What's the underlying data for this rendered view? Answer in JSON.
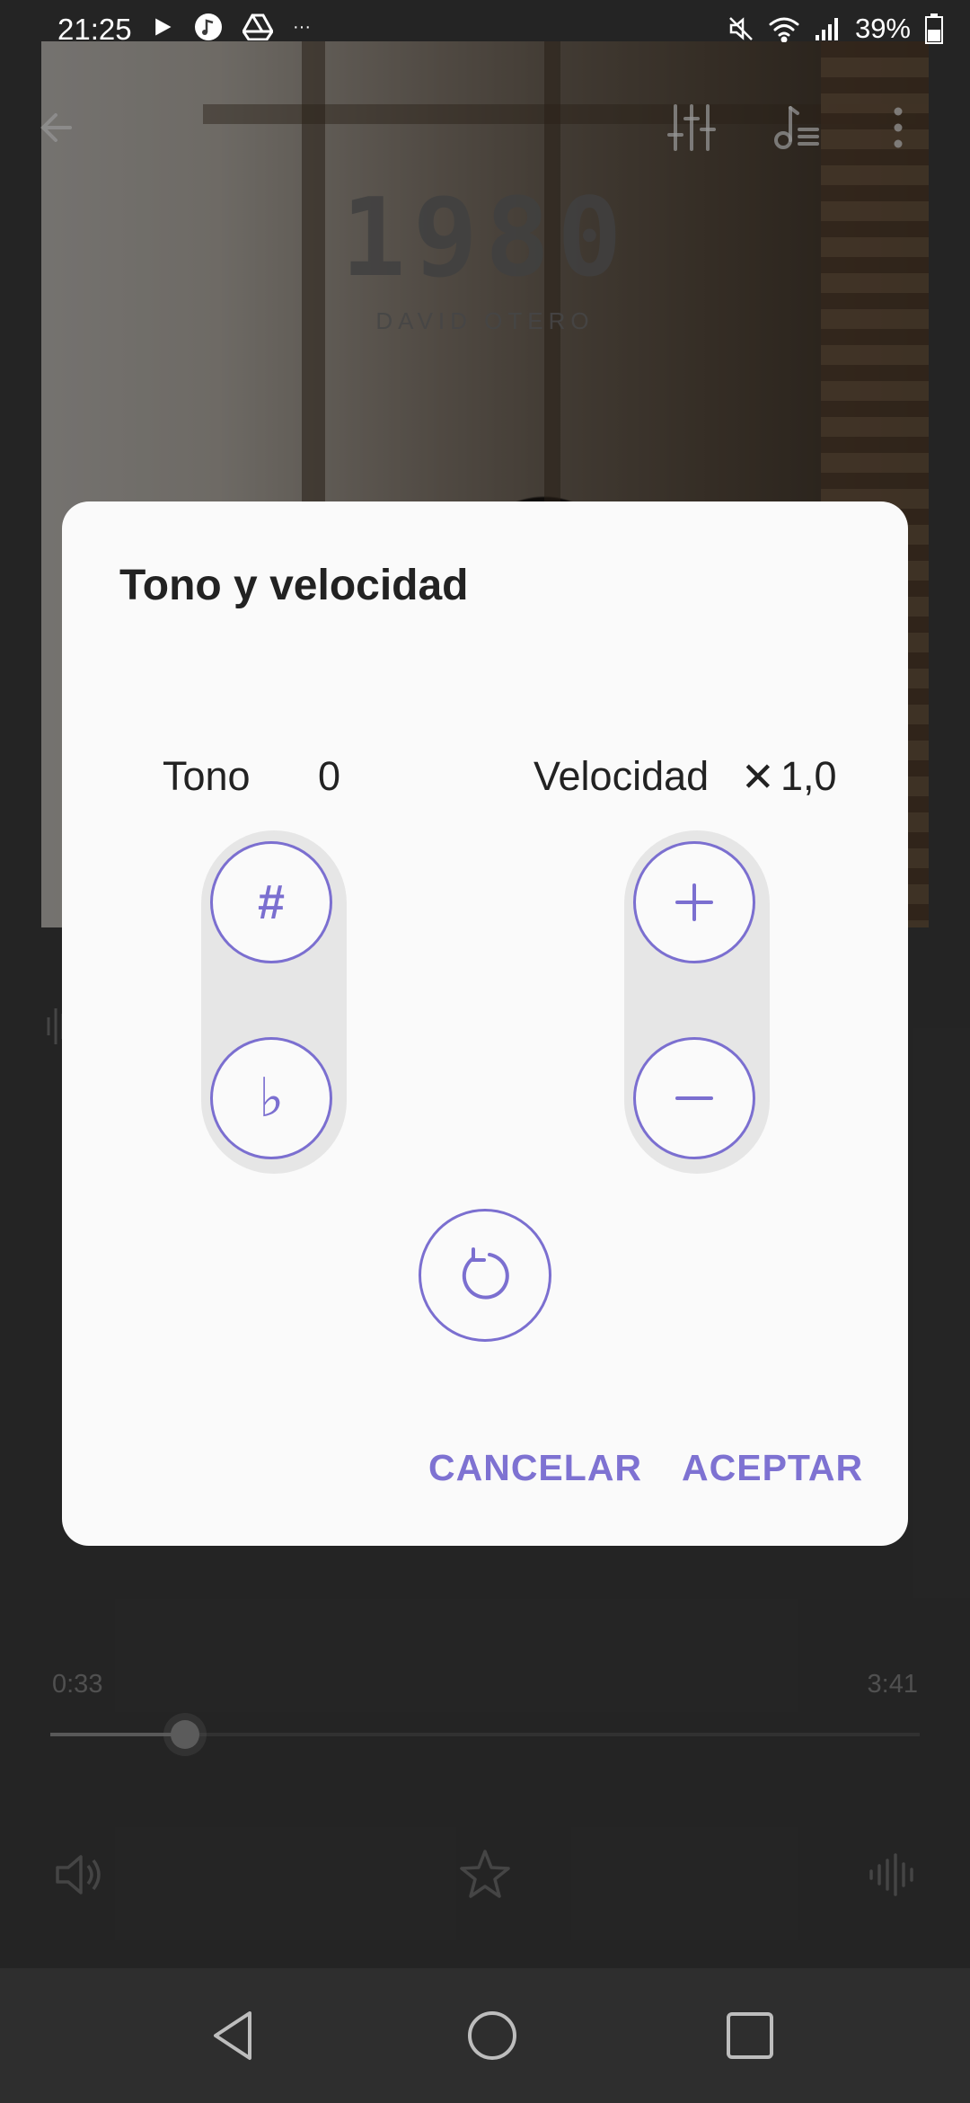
{
  "status_bar": {
    "time": "21:25",
    "battery": "39%",
    "left_icons": [
      "play-icon",
      "music-note-icon",
      "drive-icon",
      "more-dots-icon"
    ],
    "right_icons": [
      "mute-icon",
      "wifi-icon",
      "signal-icon",
      "battery-icon"
    ],
    "more": "···"
  },
  "album": {
    "title": "1980",
    "artist": "DAVID OTERO"
  },
  "player": {
    "current_time": "0:33",
    "total_time": "3:41",
    "progress": 0.155
  },
  "dialog": {
    "title": "Tono y velocidad",
    "pitch_label": "Tono",
    "pitch_value": "0",
    "speed_label": "Velocidad",
    "speed_value": "1,0",
    "speed_multiplier_glyph": "✕",
    "sharp_glyph": "#",
    "flat_glyph": "♭",
    "cancel_label": "CANCELAR",
    "accept_label": "ACEPTAR"
  },
  "colors": {
    "accent": "#7b6fd0",
    "dialog_bg": "#fafafa",
    "pill_bg": "#e6e6e6"
  }
}
